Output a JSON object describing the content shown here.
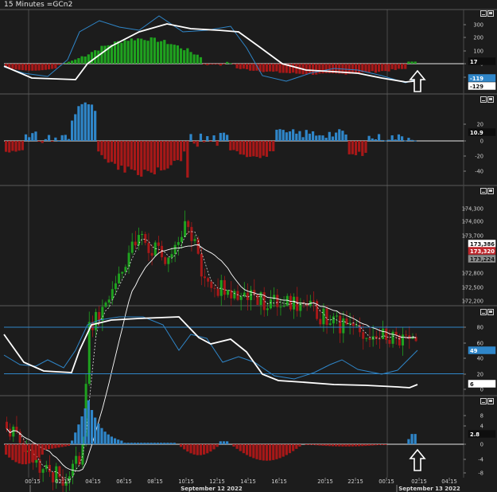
{
  "title": "15 Minutes =GCn2",
  "colors": {
    "background": "#1c1c1c",
    "grid": "#3a3a3a",
    "bull": "#1fa21f",
    "bear": "#a81818",
    "blue": "#2f86c9",
    "white": "#ffffff"
  },
  "x_axis": {
    "ticks": [
      "00:15",
      "02:15",
      "04:15",
      "06:15",
      "08:15",
      "10:15",
      "12:15",
      "14:15",
      "16:15",
      "20:15",
      "22:15",
      "00:15",
      "02:15",
      "04:15"
    ],
    "dates": [
      "September 12 2022",
      "September 13 2022"
    ]
  },
  "panels": [
    {
      "id": "macd-oscillator",
      "ticks": [
        "300",
        "200",
        "100",
        "0",
        "-100"
      ],
      "badges": [
        {
          "text": "17",
          "style": "dark"
        },
        {
          "text": "-119",
          "style": "blue"
        },
        {
          "text": "-129",
          "style": "white"
        }
      ]
    },
    {
      "id": "histogram-oscillator",
      "ticks": [
        "20",
        "10.9",
        "0",
        "-20",
        "-40"
      ],
      "badges": [
        {
          "text": "10.9",
          "style": "dark"
        }
      ]
    },
    {
      "id": "price",
      "ticks": [
        "174,300",
        "174,000",
        "173,700",
        "173,386",
        "173,320",
        "173,224",
        "172,800",
        "172,500",
        "172,200"
      ],
      "badges": [
        {
          "text": "173,386",
          "style": "white"
        },
        {
          "text": "173,320",
          "style": "red"
        },
        {
          "text": "173,224",
          "style": "grey"
        }
      ]
    },
    {
      "id": "stochastic",
      "ticks": [
        "80",
        "60",
        "40",
        "20",
        "0"
      ],
      "badges": [
        {
          "text": "49",
          "style": "blue"
        },
        {
          "text": "6",
          "style": "white"
        }
      ]
    },
    {
      "id": "momentum",
      "ticks": [
        "8",
        "4",
        "2.8",
        "0",
        "-4",
        "-8"
      ],
      "badges": [
        {
          "text": "2.8",
          "style": "dark"
        }
      ]
    }
  ],
  "icons": [
    "minimize-icon",
    "maximize-icon",
    "arrow-up-icon"
  ]
}
